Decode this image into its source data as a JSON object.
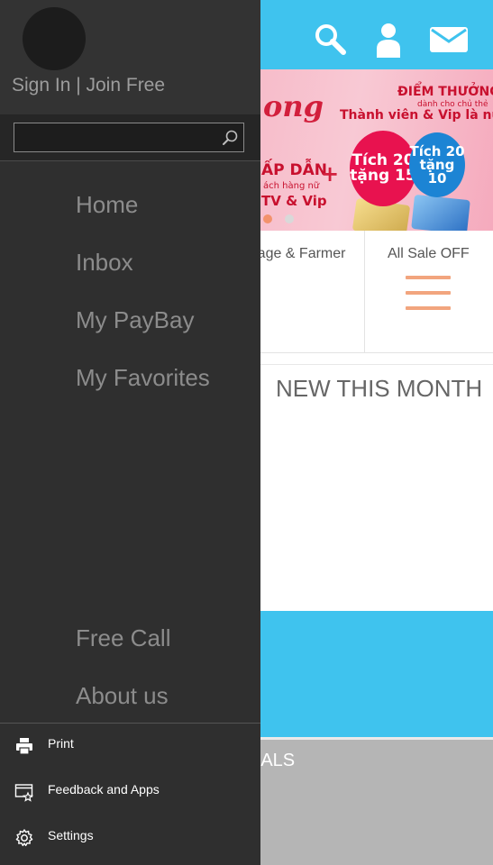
{
  "header": {
    "icons": [
      "search-icon",
      "user-icon",
      "mail-icon"
    ],
    "bg_color": "#3fc3ee"
  },
  "banner": {
    "script_fragment": "ong",
    "heading_1": "ĐIỂM THƯỞNG",
    "heading_1_sub": "dành cho chủ thẻ",
    "heading_2": "Thành viên & Vip là nữ",
    "left_line_1": "ẤP DẪN",
    "left_line_2": "ách hàng nữ",
    "left_line_3": "TV & Vip",
    "plus": "+",
    "bubble_1": [
      "Tích 20",
      "tặng 15"
    ],
    "bubble_2": [
      "Tích 20",
      "tặng 10"
    ],
    "carousel": {
      "total_dots": 2,
      "active_index": 0,
      "active_color": "#f3926c"
    }
  },
  "categories": [
    {
      "label": "illage & Farmer"
    },
    {
      "label": "All Sale OFF",
      "icon": "hamburger-icon",
      "icon_color": "#f2a57e"
    }
  ],
  "sections": {
    "new_this_month": "NEW THIS MONTH",
    "deals_fragment": "EALS"
  },
  "drawer": {
    "bg_color": "#2f2f2f",
    "signin": "Sign In | Join Free",
    "search": {
      "value": "",
      "placeholder": ""
    },
    "nav": {
      "home": "Home",
      "inbox": "Inbox",
      "mypaybay": "My PayBay",
      "favorites": "My Favorites",
      "free_call": "Free Call",
      "about": "About us"
    },
    "footer": {
      "print": "Print",
      "feedback": "Feedback and Apps",
      "settings": "Settings"
    }
  }
}
